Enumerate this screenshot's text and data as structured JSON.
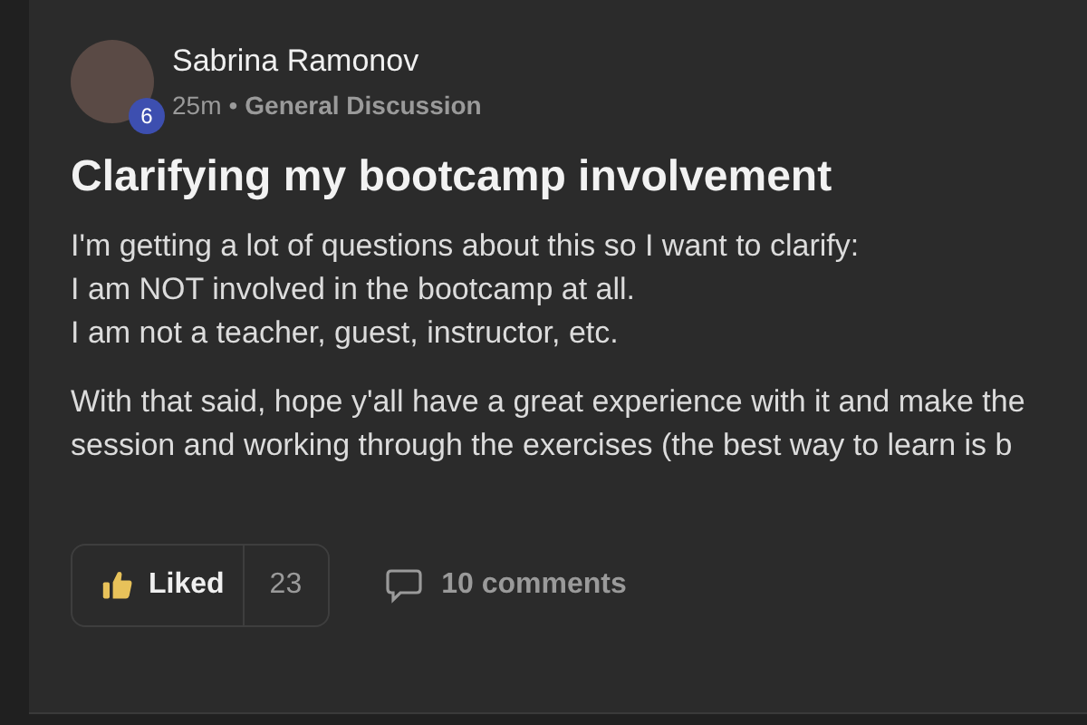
{
  "post": {
    "author": "Sabrina Ramonov",
    "level_badge": "6",
    "time": "25m",
    "separator": "•",
    "category": "General Discussion",
    "title": "Clarifying my bootcamp involvement",
    "paragraphs": [
      [
        "I'm getting a lot of questions about this so I want to clarify:",
        "I am NOT involved in the bootcamp at all.",
        "I am not a teacher, guest, instructor, etc."
      ],
      [
        "With that said, hope y'all have a great experience with it and make the",
        "session and working through the exercises (the best way to learn is b"
      ]
    ],
    "like": {
      "label": "Liked",
      "selected": true,
      "count": "23"
    },
    "comments": "10 comments"
  }
}
